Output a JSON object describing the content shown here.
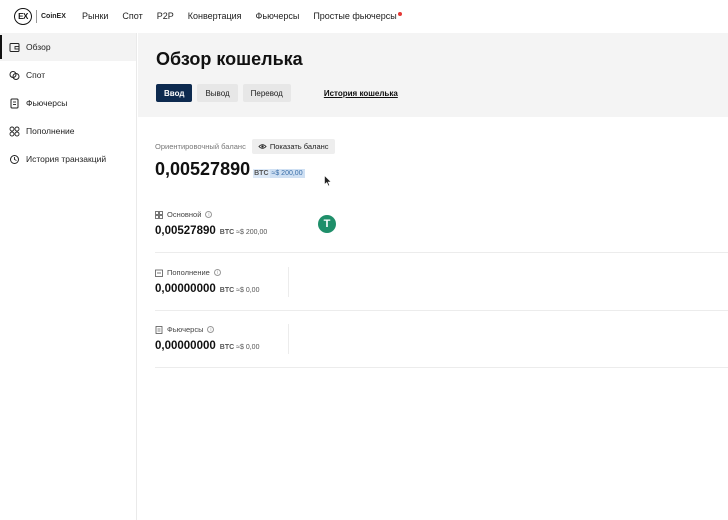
{
  "brand": {
    "logo_mark": "EX",
    "logo_text": "CoinEX"
  },
  "nav": {
    "items": [
      {
        "label": "Рынки"
      },
      {
        "label": "Спот"
      },
      {
        "label": "P2P"
      },
      {
        "label": "Конвертация"
      },
      {
        "label": "Фьючерсы"
      },
      {
        "label": "Простые фьючерсы"
      }
    ]
  },
  "sidebar": {
    "items": [
      {
        "label": "Обзор",
        "icon": "wallet-icon",
        "active": true
      },
      {
        "label": "Спот",
        "icon": "spot-icon"
      },
      {
        "label": "Фьючерсы",
        "icon": "futures-icon"
      },
      {
        "label": "Пополнение",
        "icon": "deposit-icon"
      },
      {
        "label": "История транзакций",
        "icon": "history-icon"
      }
    ]
  },
  "main": {
    "title": "Обзор кошелька",
    "tabs": {
      "deposit": "Ввод",
      "withdraw": "Вывод",
      "transfer": "Перевод",
      "history": "История кошелька"
    },
    "estimated_label": "Ориентировочный баланс",
    "show_balance": "Показать баланс",
    "total": {
      "amount": "0,00527890",
      "unit": "BTC",
      "fiat": "≈$ 200,00"
    },
    "accounts": [
      {
        "name": "Основной",
        "amount": "0,00527890",
        "unit": "BTC",
        "fiat": "≈$ 200,00"
      },
      {
        "name": "Пополнение",
        "amount": "0,00000000",
        "unit": "BTC",
        "fiat": "≈$ 0,00"
      },
      {
        "name": "Фьючерсы",
        "amount": "0,00000000",
        "unit": "BTC",
        "fiat": "≈$ 0,00"
      }
    ],
    "token_glyph": "T"
  },
  "colors": {
    "primary_button": "#0d2a4f",
    "tether_green": "#1f8f6a",
    "notification_dot": "#e53935"
  }
}
